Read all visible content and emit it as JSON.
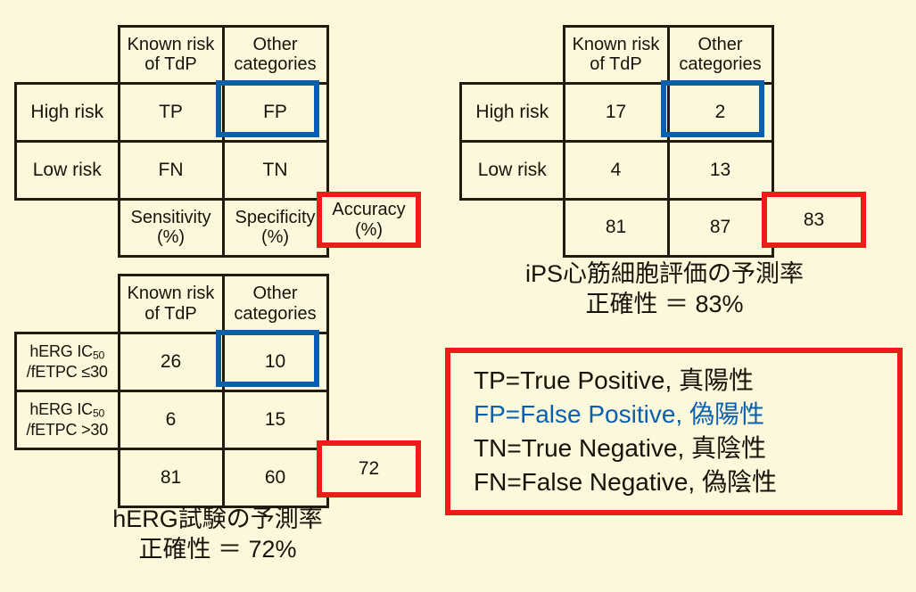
{
  "background_color": "#FCF8DC",
  "colors": {
    "grid": "#231A0E",
    "highlight_blue": "#0B60AE",
    "highlight_red": "#EE1C18",
    "text": "#1A1208"
  },
  "tables": {
    "template": {
      "name": "confusion-matrix-template",
      "corner": "",
      "headers": [
        "Known risk\nof TdP",
        "Other\ncategories"
      ],
      "header_col1_line1": "Known risk",
      "header_col1_line2": "of TdP",
      "header_col2_line1": "Other",
      "header_col2_line2": "categories",
      "rows": [
        {
          "label": "High risk",
          "cells": [
            "TP",
            "FP"
          ]
        },
        {
          "label": "Low risk",
          "cells": [
            "FN",
            "TN"
          ]
        }
      ],
      "metrics": {
        "sensitivity_line1": "Sensitivity",
        "sensitivity_line2": "(%)",
        "specificity_line1": "Specificity",
        "specificity_line2": "(%)",
        "accuracy_line1": "Accuracy",
        "accuracy_line2": "(%)"
      }
    },
    "ips": {
      "name": "ips-cardiomyocyte-table",
      "header_col1_line1": "Known risk",
      "header_col1_line2": "of TdP",
      "header_col2_line1": "Other",
      "header_col2_line2": "categories",
      "rows": [
        {
          "label": "High risk",
          "cells": [
            "17",
            "2"
          ]
        },
        {
          "label": "Low risk",
          "cells": [
            "4",
            "13"
          ]
        }
      ],
      "metrics": {
        "sensitivity": "81",
        "specificity": "87",
        "accuracy": "83"
      },
      "caption_line1": "iPS心筋細胞評価の予測率",
      "caption_line2": "正確性 ＝ 83%"
    },
    "herg": {
      "name": "herg-assay-table",
      "header_col1_line1": "Known risk",
      "header_col1_line2": "of TdP",
      "header_col2_line1": "Other",
      "header_col2_line2": "categories",
      "rows": [
        {
          "label_prefix": "hERG IC",
          "label_sub": "50",
          "label_line2": "/fETPC ≤30",
          "cells": [
            "26",
            "10"
          ]
        },
        {
          "label_prefix": "hERG IC",
          "label_sub": "50",
          "label_line2": "/fETPC >30",
          "cells": [
            "6",
            "15"
          ]
        }
      ],
      "metrics": {
        "sensitivity": "81",
        "specificity": "60",
        "accuracy": "72"
      },
      "caption_line1": "hERG試験の予測率",
      "caption_line2": "正確性 ＝ 72%"
    }
  },
  "legend": {
    "name": "abbreviation-legend",
    "lines": [
      {
        "text": "TP=True Positive,  真陽性",
        "color": "#1A1208"
      },
      {
        "text": "FP=False Positive,  偽陽性",
        "color": "#0B60AE"
      },
      {
        "text": "TN=True Negative,  真陰性",
        "color": "#1A1208"
      },
      {
        "text": "FN=False Negative,  偽陰性",
        "color": "#1A1208"
      }
    ],
    "line1": "TP=True Positive,  真陽性",
    "line2": "FP=False Positive,  偽陽性",
    "line3": "TN=True Negative,  真陰性",
    "line4": "FN=False Negative,  偽陰性"
  }
}
